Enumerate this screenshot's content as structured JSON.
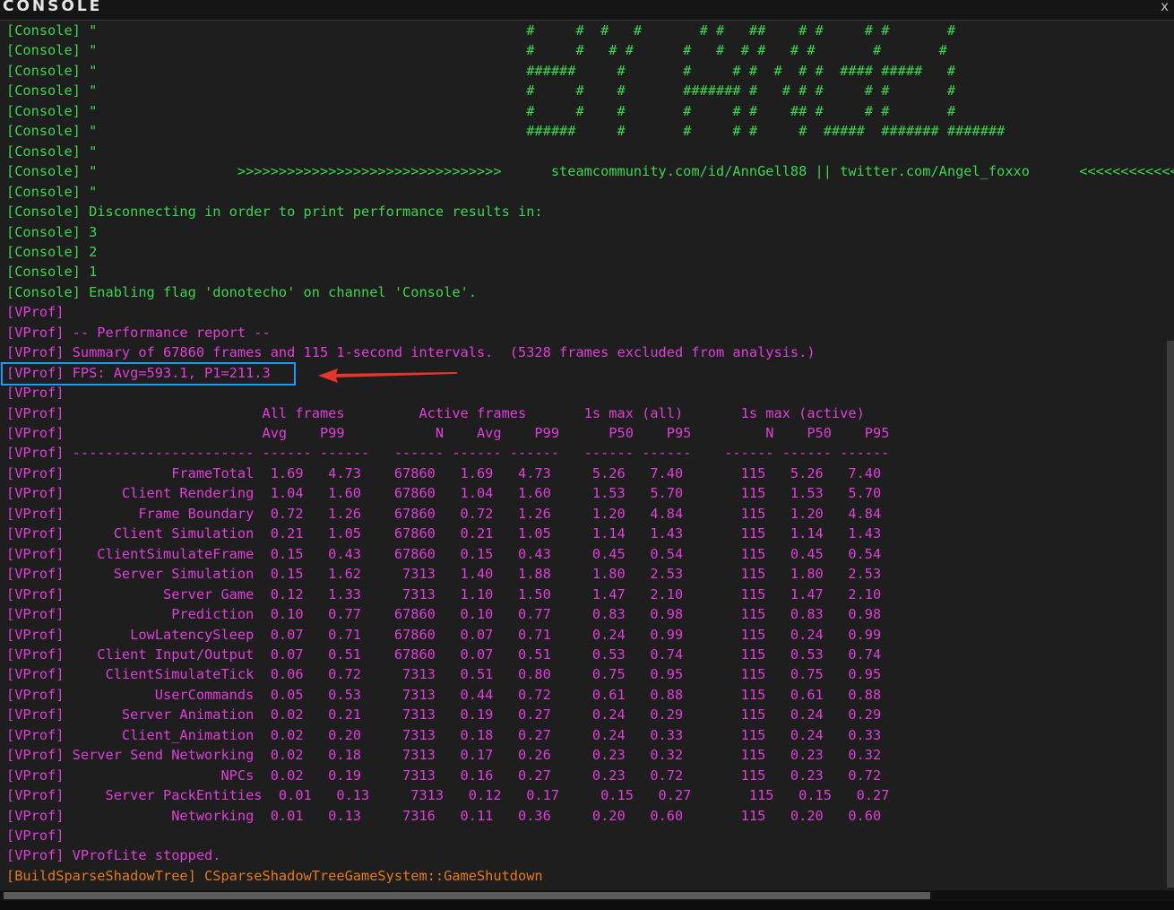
{
  "window": {
    "title": "CONSOLE",
    "close_label": "x"
  },
  "lines": [
    {
      "ch": "Console",
      "text": "[Console] \"                                                    #     #  #   #       # #   ##    # #     # #       #"
    },
    {
      "ch": "Console",
      "text": "[Console] \"                                                    #     #   # #      #   #  # #   # #       #       #"
    },
    {
      "ch": "Console",
      "text": "[Console] \"                                                    ######     #       #     # #  #  # #  #### #####   #"
    },
    {
      "ch": "Console",
      "text": "[Console] \"                                                    #     #    #       ####### #   # # #     # #       #"
    },
    {
      "ch": "Console",
      "text": "[Console] \"                                                    #     #    #       #     # #    ## #     # #       #"
    },
    {
      "ch": "Console",
      "text": "[Console] \"                                                    ######     #       #     # #     #  #####  ####### #######"
    },
    {
      "ch": "Console",
      "text": "[Console] \""
    },
    {
      "ch": "Console",
      "text": "[Console] \"                 >>>>>>>>>>>>>>>>>>>>>>>>>>>>>>>>      steamcommunity.com/id/AnnGell88 || twitter.com/Angel_foxxo      <<<<<<<<<<<<"
    },
    {
      "ch": "Console",
      "text": "[Console] \""
    },
    {
      "ch": "Console",
      "text": "[Console] Disconnecting in order to print performance results in:"
    },
    {
      "ch": "Console",
      "text": "[Console] 3"
    },
    {
      "ch": "Console",
      "text": "[Console] 2"
    },
    {
      "ch": "Console",
      "text": "[Console] 1"
    },
    {
      "ch": "Console",
      "text": "[Console] Enabling flag 'donotecho' on channel 'Console'."
    },
    {
      "ch": "VProf",
      "text": "[VProf]"
    },
    {
      "ch": "VProf",
      "text": "[VProf] -- Performance report --"
    },
    {
      "ch": "VProf",
      "text": "[VProf] Summary of 67860 frames and 115 1-second intervals.  (5328 frames excluded from analysis.)"
    },
    {
      "ch": "VProf",
      "text": "[VProf] FPS: Avg=593.1, P1=211.3"
    },
    {
      "ch": "VProf",
      "text": "[VProf]"
    },
    {
      "ch": "VProf",
      "text": "[VProf]                        All frames         Active frames       1s max (all)       1s max (active)"
    },
    {
      "ch": "VProf",
      "text": "[VProf]                        Avg    P99           N    Avg    P99      P50    P95         N    P50    P95"
    },
    {
      "ch": "VProf",
      "text": "[VProf] ---------------------- ------ ------   ------ ------ ------   ------ ------    ------ ------ ------"
    },
    {
      "ch": "VProf",
      "text": "[VProf]             FrameTotal  1.69   4.73    67860   1.69   4.73     5.26   7.40       115   5.26   7.40"
    },
    {
      "ch": "VProf",
      "text": "[VProf]       Client Rendering  1.04   1.60    67860   1.04   1.60     1.53   5.70       115   1.53   5.70"
    },
    {
      "ch": "VProf",
      "text": "[VProf]         Frame Boundary  0.72   1.26    67860   0.72   1.26     1.20   4.84       115   1.20   4.84"
    },
    {
      "ch": "VProf",
      "text": "[VProf]      Client Simulation  0.21   1.05    67860   0.21   1.05     1.14   1.43       115   1.14   1.43"
    },
    {
      "ch": "VProf",
      "text": "[VProf]    ClientSimulateFrame  0.15   0.43    67860   0.15   0.43     0.45   0.54       115   0.45   0.54"
    },
    {
      "ch": "VProf",
      "text": "[VProf]      Server Simulation  0.15   1.62     7313   1.40   1.88     1.80   2.53       115   1.80   2.53"
    },
    {
      "ch": "VProf",
      "text": "[VProf]            Server Game  0.12   1.33     7313   1.10   1.50     1.47   2.10       115   1.47   2.10"
    },
    {
      "ch": "VProf",
      "text": "[VProf]             Prediction  0.10   0.77    67860   0.10   0.77     0.83   0.98       115   0.83   0.98"
    },
    {
      "ch": "VProf",
      "text": "[VProf]        LowLatencySleep  0.07   0.71    67860   0.07   0.71     0.24   0.99       115   0.24   0.99"
    },
    {
      "ch": "VProf",
      "text": "[VProf]    Client Input/Output  0.07   0.51    67860   0.07   0.51     0.53   0.74       115   0.53   0.74"
    },
    {
      "ch": "VProf",
      "text": "[VProf]     ClientSimulateTick  0.06   0.72     7313   0.51   0.80     0.75   0.95       115   0.75   0.95"
    },
    {
      "ch": "VProf",
      "text": "[VProf]           UserCommands  0.05   0.53     7313   0.44   0.72     0.61   0.88       115   0.61   0.88"
    },
    {
      "ch": "VProf",
      "text": "[VProf]       Server Animation  0.02   0.21     7313   0.19   0.27     0.24   0.29       115   0.24   0.29"
    },
    {
      "ch": "VProf",
      "text": "[VProf]       Client_Animation  0.02   0.20     7313   0.18   0.27     0.24   0.33       115   0.24   0.33"
    },
    {
      "ch": "VProf",
      "text": "[VProf] Server Send Networking  0.02   0.18     7313   0.17   0.26     0.23   0.32       115   0.23   0.32"
    },
    {
      "ch": "VProf",
      "text": "[VProf]                   NPCs  0.02   0.19     7313   0.16   0.27     0.23   0.72       115   0.23   0.72"
    },
    {
      "ch": "VProf",
      "text": "[VProf]     Server PackEntities  0.01   0.13     7313   0.12   0.17     0.15   0.27       115   0.15   0.27"
    },
    {
      "ch": "VProf",
      "text": "[VProf]             Networking  0.01   0.13     7316   0.11   0.36     0.20   0.60       115   0.20   0.60"
    },
    {
      "ch": "VProf",
      "text": "[VProf]"
    },
    {
      "ch": "VProf",
      "text": "[VProf] VProfLite stopped."
    },
    {
      "ch": "Build",
      "text": "[BuildSparseShadowTree] CSparseShadowTreeGameSystem::GameShutdown"
    }
  ],
  "colors": {
    "Console": "#3bd64e",
    "VProf": "#df3fd8",
    "Build": "#e57b14",
    "highlight_box": "#1b9cf1",
    "annotation_arrow": "#e8352b"
  },
  "annotation": {
    "highlighted_line": 17,
    "icon": "red-arrow-icon"
  }
}
